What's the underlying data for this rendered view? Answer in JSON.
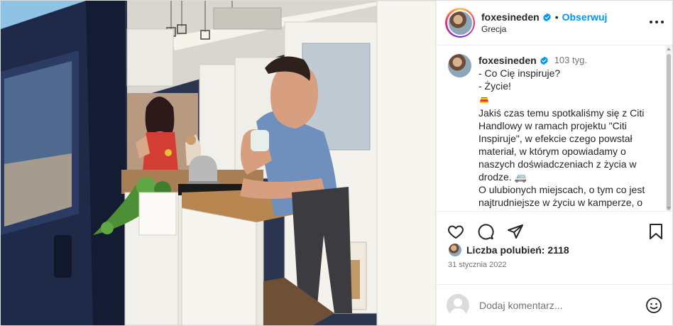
{
  "post": {
    "username": "foxesineden",
    "follow_label": "Obserwuj",
    "location": "Grecja",
    "dot": "•"
  },
  "caption": {
    "username": "foxesineden",
    "time": "103 tyg.",
    "lines": [
      "- Co Cię inspiruje?",
      "- Życie!",
      "",
      "Jakiś czas temu spotkaliśmy się z Citi Handlowy w ramach projektu \"Citi Inspiruje\", w efekcie czego powstał materiał, w którym opowiadamy o naszych doświadczeniach z życia w drodze. 🚐",
      "O ulubionych miejscach, o tym co jest najtrudniejsze w życiu w kamperze, o"
    ]
  },
  "likes": {
    "label": "Liczba polubień: 2118"
  },
  "date": "31 stycznia 2022",
  "comment": {
    "placeholder": "Dodaj komentarz..."
  },
  "icons": {
    "verified": "verified-badge-icon",
    "more": "more-options-icon",
    "like": "heart-icon",
    "comment": "comment-icon",
    "share": "paper-plane-icon",
    "save": "bookmark-icon",
    "emoji": "smiley-icon"
  },
  "colors": {
    "accent": "#0095f6",
    "verified": "#0095f6",
    "text": "#262626",
    "muted": "#737373"
  }
}
